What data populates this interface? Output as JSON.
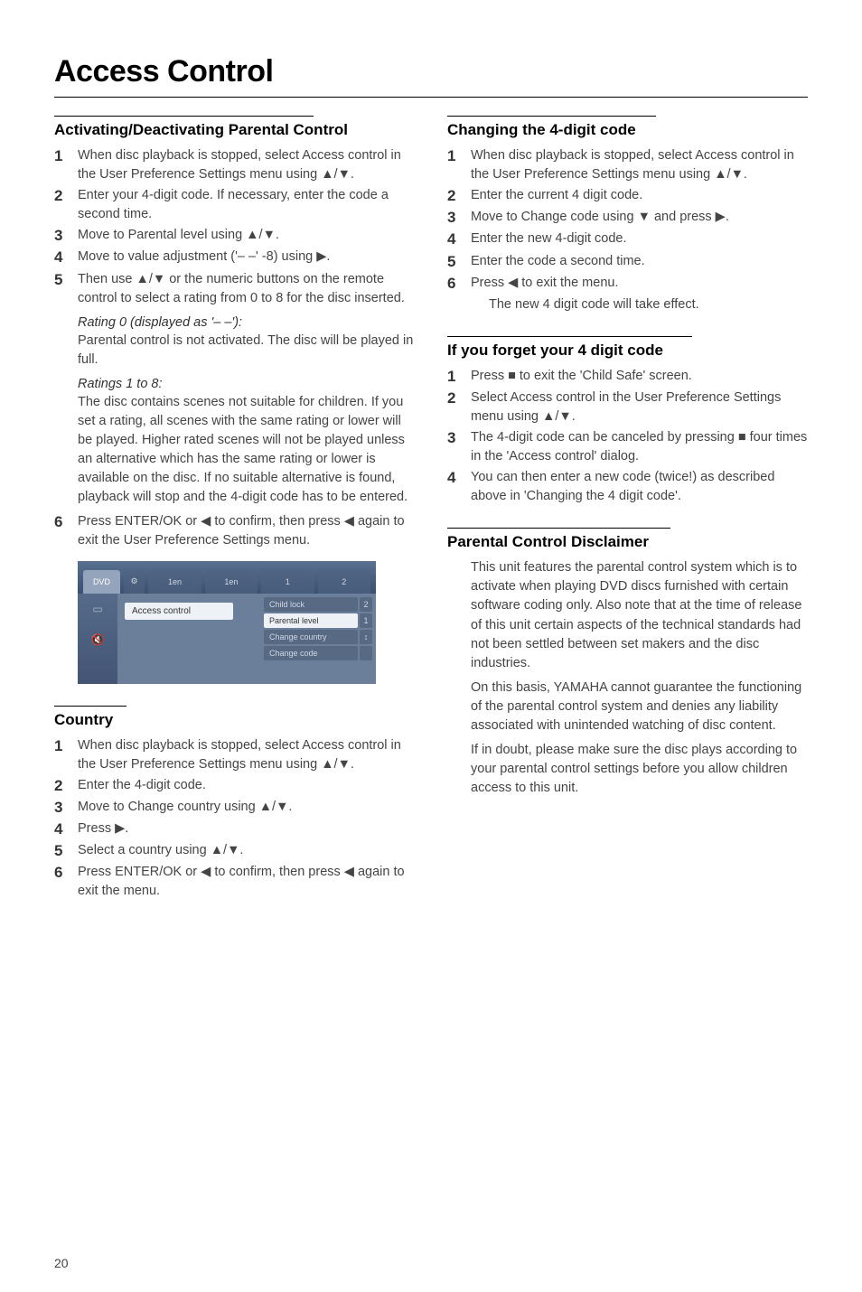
{
  "pageTitle": "Access Control",
  "pageNumber": "20",
  "left": {
    "sec1": {
      "title": "Activating/Deactivating Parental Control",
      "s1": "When disc playback is stopped, select Access control in the User Preference Settings menu using ▲/▼.",
      "s2": "Enter your 4-digit code. If necessary, enter the code a second time.",
      "s3": "Move to Parental level using ▲/▼.",
      "s4": "Move to value adjustment ('– –' -8) using ▶.",
      "s5": "Then use ▲/▼ or the numeric buttons on the remote control to select a rating from 0 to 8 for the disc inserted.",
      "r0label": "Rating 0 (displayed as '– –'):",
      "r0text": "Parental control is not activated. The disc will be played in full.",
      "r1label": "Ratings 1 to 8:",
      "r1text": "The disc contains scenes not suitable for children. If you set a rating, all scenes with the same rating or lower will be played. Higher rated scenes will not be played unless an alternative which has the same rating or lower is available on the disc. If no suitable alternative is found, playback will stop and the 4-digit code has to be entered.",
      "s6": "Press ENTER/OK or ◀ to confirm, then press ◀ again to exit the User Preference Settings menu."
    },
    "sec2": {
      "title": "Country",
      "s1": "When disc playback is stopped, select Access control in the User Preference Settings menu using ▲/▼.",
      "s2": "Enter the 4-digit code.",
      "s3": "Move to Change country using ▲/▼.",
      "s4": "Press ▶.",
      "s5": "Select a country using ▲/▼.",
      "s6": "Press ENTER/OK or ◀ to confirm, then press ◀ again to exit the menu."
    },
    "screenshot": {
      "tab_dvd": "DVD",
      "tab_1en_a": "1en",
      "tab_1en_b": "1en",
      "tab_1": "1",
      "tab_2": "2",
      "menu_item": "Access control",
      "opt1": "Child lock",
      "opt2": "Parental level",
      "opt3": "Change country",
      "opt4": "Change code",
      "num_top": "2",
      "num_bot": "1"
    }
  },
  "right": {
    "sec1": {
      "title": "Changing the 4-digit code",
      "s1": "When disc playback is stopped, select Access control in the User Preference Settings menu using ▲/▼.",
      "s2": "Enter the current 4 digit code.",
      "s3": "Move to Change code using ▼ and press ▶.",
      "s4": "Enter the new 4-digit code.",
      "s5": "Enter the code a second time.",
      "s6": "Press ◀ to exit the menu.",
      "result": "The new 4 digit code will take effect."
    },
    "sec2": {
      "title": "If you forget your 4 digit code",
      "s1": "Press ■ to exit the 'Child Safe' screen.",
      "s2": "Select Access control in the User Preference Settings menu using ▲/▼.",
      "s3": "The 4-digit code can be canceled by pressing ■ four times in the 'Access control' dialog.",
      "s4": "You can then enter a new code (twice!) as described above in 'Changing the 4 digit code'."
    },
    "sec3": {
      "title": "Parental Control Disclaimer",
      "p1": "This unit features the parental control system which is to activate when playing DVD discs furnished with certain software coding only. Also note that at the time of release of this unit certain aspects of the technical standards had not been settled between set makers and the disc industries.",
      "p2": "On this basis, YAMAHA cannot guarantee the functioning of the parental control system and denies any liability associated with unintended watching of disc content.",
      "p3": "If in doubt, please make sure the disc plays according to your parental control settings before you allow children access to this unit."
    }
  }
}
